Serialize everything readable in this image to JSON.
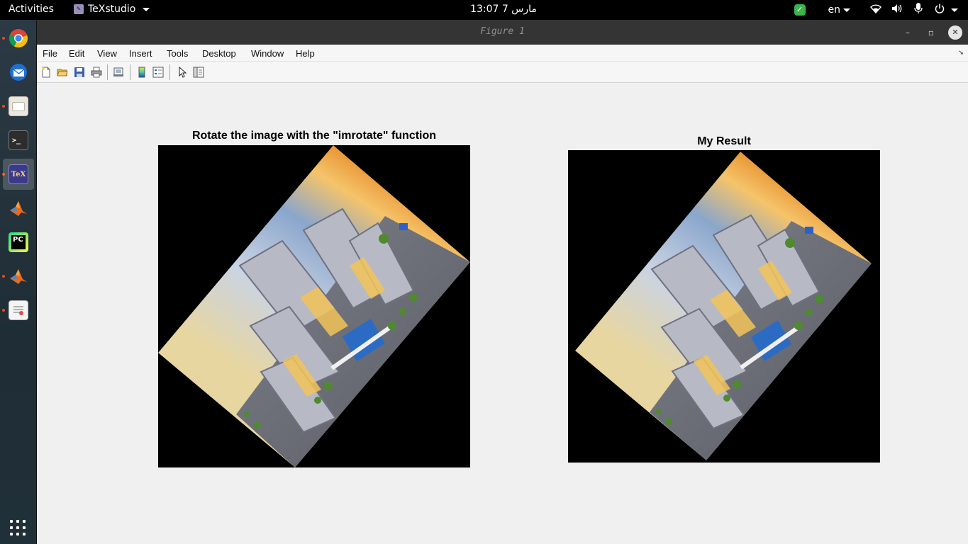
{
  "topbar": {
    "activities": "Activities",
    "app_name": "TeXstudio",
    "clock": "13:07 مارس 7",
    "language": "en"
  },
  "dock": {
    "items": [
      {
        "name": "chrome-icon",
        "running": true
      },
      {
        "name": "thunderbird-icon",
        "running": false
      },
      {
        "name": "files-icon",
        "running": true
      },
      {
        "name": "terminal-icon",
        "running": false
      },
      {
        "name": "texstudio-icon",
        "running": true,
        "active": true,
        "label": "TeX"
      },
      {
        "name": "matlab-icon",
        "running": false
      },
      {
        "name": "pycharm-icon",
        "running": false,
        "label": "PC"
      },
      {
        "name": "matlab-icon",
        "running": true
      },
      {
        "name": "document-viewer-icon",
        "running": true
      }
    ]
  },
  "window": {
    "title": "Figure 1",
    "menu": [
      {
        "label": "File",
        "key": "F"
      },
      {
        "label": "Edit",
        "key": "E"
      },
      {
        "label": "View",
        "key": "V"
      },
      {
        "label": "Insert",
        "key": "I"
      },
      {
        "label": "Tools",
        "key": "T"
      },
      {
        "label": "Desktop",
        "key": "D"
      },
      {
        "label": "Window",
        "key": "W"
      },
      {
        "label": "Help",
        "key": "H"
      }
    ]
  },
  "figure": {
    "left_title": "Rotate the image with the \"imrotate\" function",
    "right_title": "My Result"
  },
  "colors": {
    "topbar": "#000000",
    "titlebar": "#343434",
    "figure_bg": "#f0f0f0",
    "axes_bg": "#000000",
    "accent_green": "#3ab54a"
  }
}
